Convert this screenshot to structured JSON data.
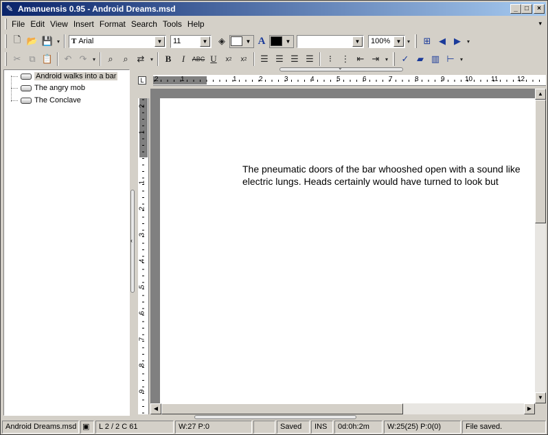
{
  "window": {
    "title": "Amanuensis 0.95 - Android Dreams.msd",
    "minimize": "_",
    "maximize": "□",
    "close": "×"
  },
  "menu": [
    "File",
    "Edit",
    "View",
    "Insert",
    "Format",
    "Search",
    "Tools",
    "Help"
  ],
  "format_toolbar": {
    "font": "Arial",
    "font_icon": "T",
    "size": "11",
    "style": "",
    "zoom": "100%",
    "text_color": "#000000",
    "fill_color": "#ffffff"
  },
  "outline": {
    "items": [
      {
        "label": "Android walks into a bar",
        "selected": true
      },
      {
        "label": "The angry mob",
        "selected": false
      },
      {
        "label": "The Conclave",
        "selected": false
      }
    ]
  },
  "ruler": {
    "horizontal": [
      "2",
      "1",
      "1",
      "2",
      "3",
      "4",
      "5",
      "6",
      "7",
      "8",
      "9",
      "10",
      "11",
      "12"
    ],
    "vertical": [
      "2",
      "1",
      "1",
      "2",
      "3",
      "4",
      "5",
      "6",
      "7",
      "8",
      "9"
    ],
    "corner": "L"
  },
  "document": {
    "text": "The pneumatic doors of the bar whooshed open with a sound like\nelectric lungs. Heads certainly would have turned to look but"
  },
  "status": {
    "file": "Android Dreams.msd",
    "position": "L 2 / 2  C 61",
    "counts": "W:27  P:0",
    "saved": "Saved",
    "mode": "INS",
    "time": "0d:0h:2m",
    "session": "W:25(25)  P:0(0)",
    "message": "File saved."
  }
}
